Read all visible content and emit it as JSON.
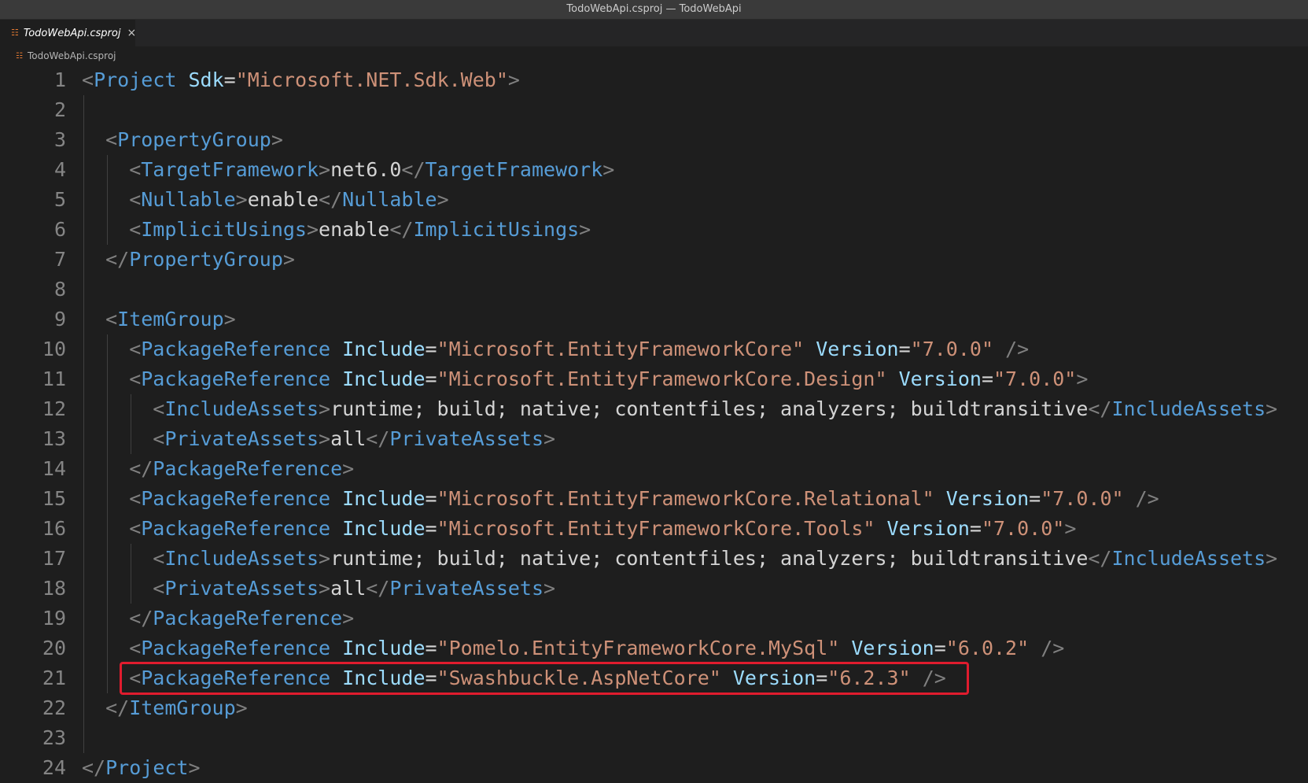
{
  "window": {
    "title": "TodoWebApi.csproj — TodoWebApi"
  },
  "tab": {
    "label": "TodoWebApi.csproj",
    "icon": "rss-file-icon",
    "close": "×"
  },
  "breadcrumb": {
    "label": "TodoWebApi.csproj",
    "icon": "rss-file-icon"
  },
  "lines": [
    {
      "n": "1",
      "indent": 0,
      "tokens": [
        [
          "p",
          "<"
        ],
        [
          "t",
          "Project"
        ],
        [
          "x",
          " "
        ],
        [
          "a",
          "Sdk"
        ],
        [
          "x",
          "="
        ],
        [
          "s",
          "\"Microsoft.NET.Sdk.Web\""
        ],
        [
          "p",
          ">"
        ]
      ]
    },
    {
      "n": "2",
      "indent": 1,
      "tokens": []
    },
    {
      "n": "3",
      "indent": 1,
      "tokens": [
        [
          "p",
          "<"
        ],
        [
          "t",
          "PropertyGroup"
        ],
        [
          "p",
          ">"
        ]
      ]
    },
    {
      "n": "4",
      "indent": 2,
      "tokens": [
        [
          "p",
          "<"
        ],
        [
          "t",
          "TargetFramework"
        ],
        [
          "p",
          ">"
        ],
        [
          "x",
          "net6.0"
        ],
        [
          "p",
          "</"
        ],
        [
          "t",
          "TargetFramework"
        ],
        [
          "p",
          ">"
        ]
      ]
    },
    {
      "n": "5",
      "indent": 2,
      "tokens": [
        [
          "p",
          "<"
        ],
        [
          "t",
          "Nullable"
        ],
        [
          "p",
          ">"
        ],
        [
          "x",
          "enable"
        ],
        [
          "p",
          "</"
        ],
        [
          "t",
          "Nullable"
        ],
        [
          "p",
          ">"
        ]
      ]
    },
    {
      "n": "6",
      "indent": 2,
      "tokens": [
        [
          "p",
          "<"
        ],
        [
          "t",
          "ImplicitUsings"
        ],
        [
          "p",
          ">"
        ],
        [
          "x",
          "enable"
        ],
        [
          "p",
          "</"
        ],
        [
          "t",
          "ImplicitUsings"
        ],
        [
          "p",
          ">"
        ]
      ]
    },
    {
      "n": "7",
      "indent": 1,
      "tokens": [
        [
          "p",
          "</"
        ],
        [
          "t",
          "PropertyGroup"
        ],
        [
          "p",
          ">"
        ]
      ]
    },
    {
      "n": "8",
      "indent": 1,
      "tokens": []
    },
    {
      "n": "9",
      "indent": 1,
      "tokens": [
        [
          "p",
          "<"
        ],
        [
          "t",
          "ItemGroup"
        ],
        [
          "p",
          ">"
        ]
      ]
    },
    {
      "n": "10",
      "indent": 2,
      "tokens": [
        [
          "p",
          "<"
        ],
        [
          "t",
          "PackageReference"
        ],
        [
          "x",
          " "
        ],
        [
          "a",
          "Include"
        ],
        [
          "x",
          "="
        ],
        [
          "s",
          "\"Microsoft.EntityFrameworkCore\""
        ],
        [
          "x",
          " "
        ],
        [
          "a",
          "Version"
        ],
        [
          "x",
          "="
        ],
        [
          "s",
          "\"7.0.0\""
        ],
        [
          "x",
          " "
        ],
        [
          "p",
          "/>"
        ]
      ]
    },
    {
      "n": "11",
      "indent": 2,
      "tokens": [
        [
          "p",
          "<"
        ],
        [
          "t",
          "PackageReference"
        ],
        [
          "x",
          " "
        ],
        [
          "a",
          "Include"
        ],
        [
          "x",
          "="
        ],
        [
          "s",
          "\"Microsoft.EntityFrameworkCore.Design\""
        ],
        [
          "x",
          " "
        ],
        [
          "a",
          "Version"
        ],
        [
          "x",
          "="
        ],
        [
          "s",
          "\"7.0.0\""
        ],
        [
          "p",
          ">"
        ]
      ]
    },
    {
      "n": "12",
      "indent": 3,
      "tokens": [
        [
          "p",
          "<"
        ],
        [
          "t",
          "IncludeAssets"
        ],
        [
          "p",
          ">"
        ],
        [
          "x",
          "runtime; build; native; contentfiles; analyzers; buildtransitive"
        ],
        [
          "p",
          "</"
        ],
        [
          "t",
          "IncludeAssets"
        ],
        [
          "p",
          ">"
        ]
      ]
    },
    {
      "n": "13",
      "indent": 3,
      "tokens": [
        [
          "p",
          "<"
        ],
        [
          "t",
          "PrivateAssets"
        ],
        [
          "p",
          ">"
        ],
        [
          "x",
          "all"
        ],
        [
          "p",
          "</"
        ],
        [
          "t",
          "PrivateAssets"
        ],
        [
          "p",
          ">"
        ]
      ]
    },
    {
      "n": "14",
      "indent": 2,
      "tokens": [
        [
          "p",
          "</"
        ],
        [
          "t",
          "PackageReference"
        ],
        [
          "p",
          ">"
        ]
      ]
    },
    {
      "n": "15",
      "indent": 2,
      "tokens": [
        [
          "p",
          "<"
        ],
        [
          "t",
          "PackageReference"
        ],
        [
          "x",
          " "
        ],
        [
          "a",
          "Include"
        ],
        [
          "x",
          "="
        ],
        [
          "s",
          "\"Microsoft.EntityFrameworkCore.Relational\""
        ],
        [
          "x",
          " "
        ],
        [
          "a",
          "Version"
        ],
        [
          "x",
          "="
        ],
        [
          "s",
          "\"7.0.0\""
        ],
        [
          "x",
          " "
        ],
        [
          "p",
          "/>"
        ]
      ]
    },
    {
      "n": "16",
      "indent": 2,
      "tokens": [
        [
          "p",
          "<"
        ],
        [
          "t",
          "PackageReference"
        ],
        [
          "x",
          " "
        ],
        [
          "a",
          "Include"
        ],
        [
          "x",
          "="
        ],
        [
          "s",
          "\"Microsoft.EntityFrameworkCore.Tools\""
        ],
        [
          "x",
          " "
        ],
        [
          "a",
          "Version"
        ],
        [
          "x",
          "="
        ],
        [
          "s",
          "\"7.0.0\""
        ],
        [
          "p",
          ">"
        ]
      ]
    },
    {
      "n": "17",
      "indent": 3,
      "tokens": [
        [
          "p",
          "<"
        ],
        [
          "t",
          "IncludeAssets"
        ],
        [
          "p",
          ">"
        ],
        [
          "x",
          "runtime; build; native; contentfiles; analyzers; buildtransitive"
        ],
        [
          "p",
          "</"
        ],
        [
          "t",
          "IncludeAssets"
        ],
        [
          "p",
          ">"
        ]
      ]
    },
    {
      "n": "18",
      "indent": 3,
      "tokens": [
        [
          "p",
          "<"
        ],
        [
          "t",
          "PrivateAssets"
        ],
        [
          "p",
          ">"
        ],
        [
          "x",
          "all"
        ],
        [
          "p",
          "</"
        ],
        [
          "t",
          "PrivateAssets"
        ],
        [
          "p",
          ">"
        ]
      ]
    },
    {
      "n": "19",
      "indent": 2,
      "tokens": [
        [
          "p",
          "</"
        ],
        [
          "t",
          "PackageReference"
        ],
        [
          "p",
          ">"
        ]
      ]
    },
    {
      "n": "20",
      "indent": 2,
      "tokens": [
        [
          "p",
          "<"
        ],
        [
          "t",
          "PackageReference"
        ],
        [
          "x",
          " "
        ],
        [
          "a",
          "Include"
        ],
        [
          "x",
          "="
        ],
        [
          "s",
          "\"Pomelo.EntityFrameworkCore.MySql\""
        ],
        [
          "x",
          " "
        ],
        [
          "a",
          "Version"
        ],
        [
          "x",
          "="
        ],
        [
          "s",
          "\"6.0.2\""
        ],
        [
          "x",
          " "
        ],
        [
          "p",
          "/>"
        ]
      ]
    },
    {
      "n": "21",
      "indent": 2,
      "highlight": true,
      "tokens": [
        [
          "p",
          "<"
        ],
        [
          "t",
          "PackageReference"
        ],
        [
          "x",
          " "
        ],
        [
          "a",
          "Include"
        ],
        [
          "x",
          "="
        ],
        [
          "s",
          "\"Swashbuckle.AspNetCore\""
        ],
        [
          "x",
          " "
        ],
        [
          "a",
          "Version"
        ],
        [
          "x",
          "="
        ],
        [
          "s",
          "\"6.2.3\""
        ],
        [
          "x",
          " "
        ],
        [
          "p",
          "/>"
        ]
      ]
    },
    {
      "n": "22",
      "indent": 1,
      "tokens": [
        [
          "p",
          "</"
        ],
        [
          "t",
          "ItemGroup"
        ],
        [
          "p",
          ">"
        ]
      ]
    },
    {
      "n": "23",
      "indent": 1,
      "tokens": []
    },
    {
      "n": "24",
      "indent": 0,
      "tokens": [
        [
          "p",
          "</"
        ],
        [
          "t",
          "Project"
        ],
        [
          "p",
          ">"
        ]
      ]
    }
  ],
  "colors": {
    "background": "#1e1e1e",
    "tag": "#569cd6",
    "attribute": "#9cdcfe",
    "string": "#ce9178",
    "punctuation": "#808080",
    "text": "#d4d4d4",
    "highlight_box": "#e01c2e"
  }
}
